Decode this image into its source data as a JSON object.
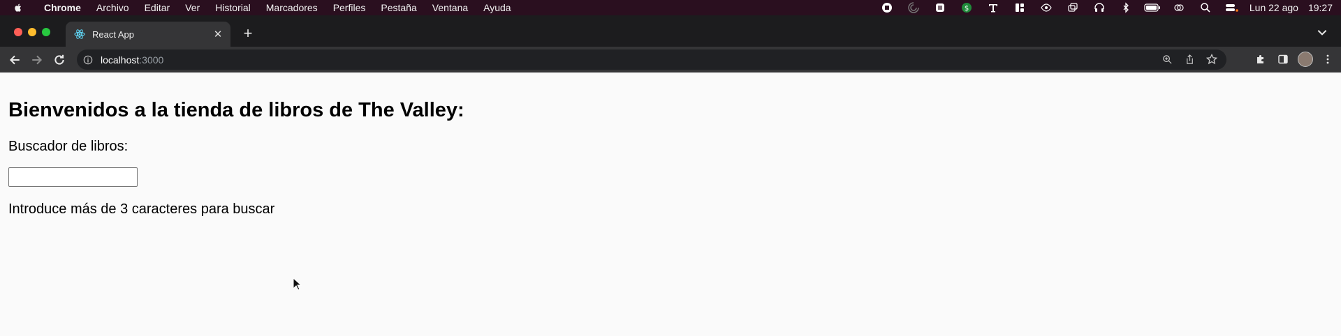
{
  "menubar": {
    "app_name": "Chrome",
    "menus": [
      "Archivo",
      "Editar",
      "Ver",
      "Historial",
      "Marcadores",
      "Perfiles",
      "Pestaña",
      "Ventana",
      "Ayuda"
    ],
    "date": "Lun 22 ago",
    "time": "19:27"
  },
  "browser": {
    "tab_title": "React App",
    "url_host": "localhost",
    "url_port": ":3000"
  },
  "page": {
    "heading": "Bienvenidos a la tienda de libros de The Valley:",
    "search_label": "Buscador de libros:",
    "search_value": "",
    "hint": "Introduce más de 3 caracteres para buscar"
  }
}
